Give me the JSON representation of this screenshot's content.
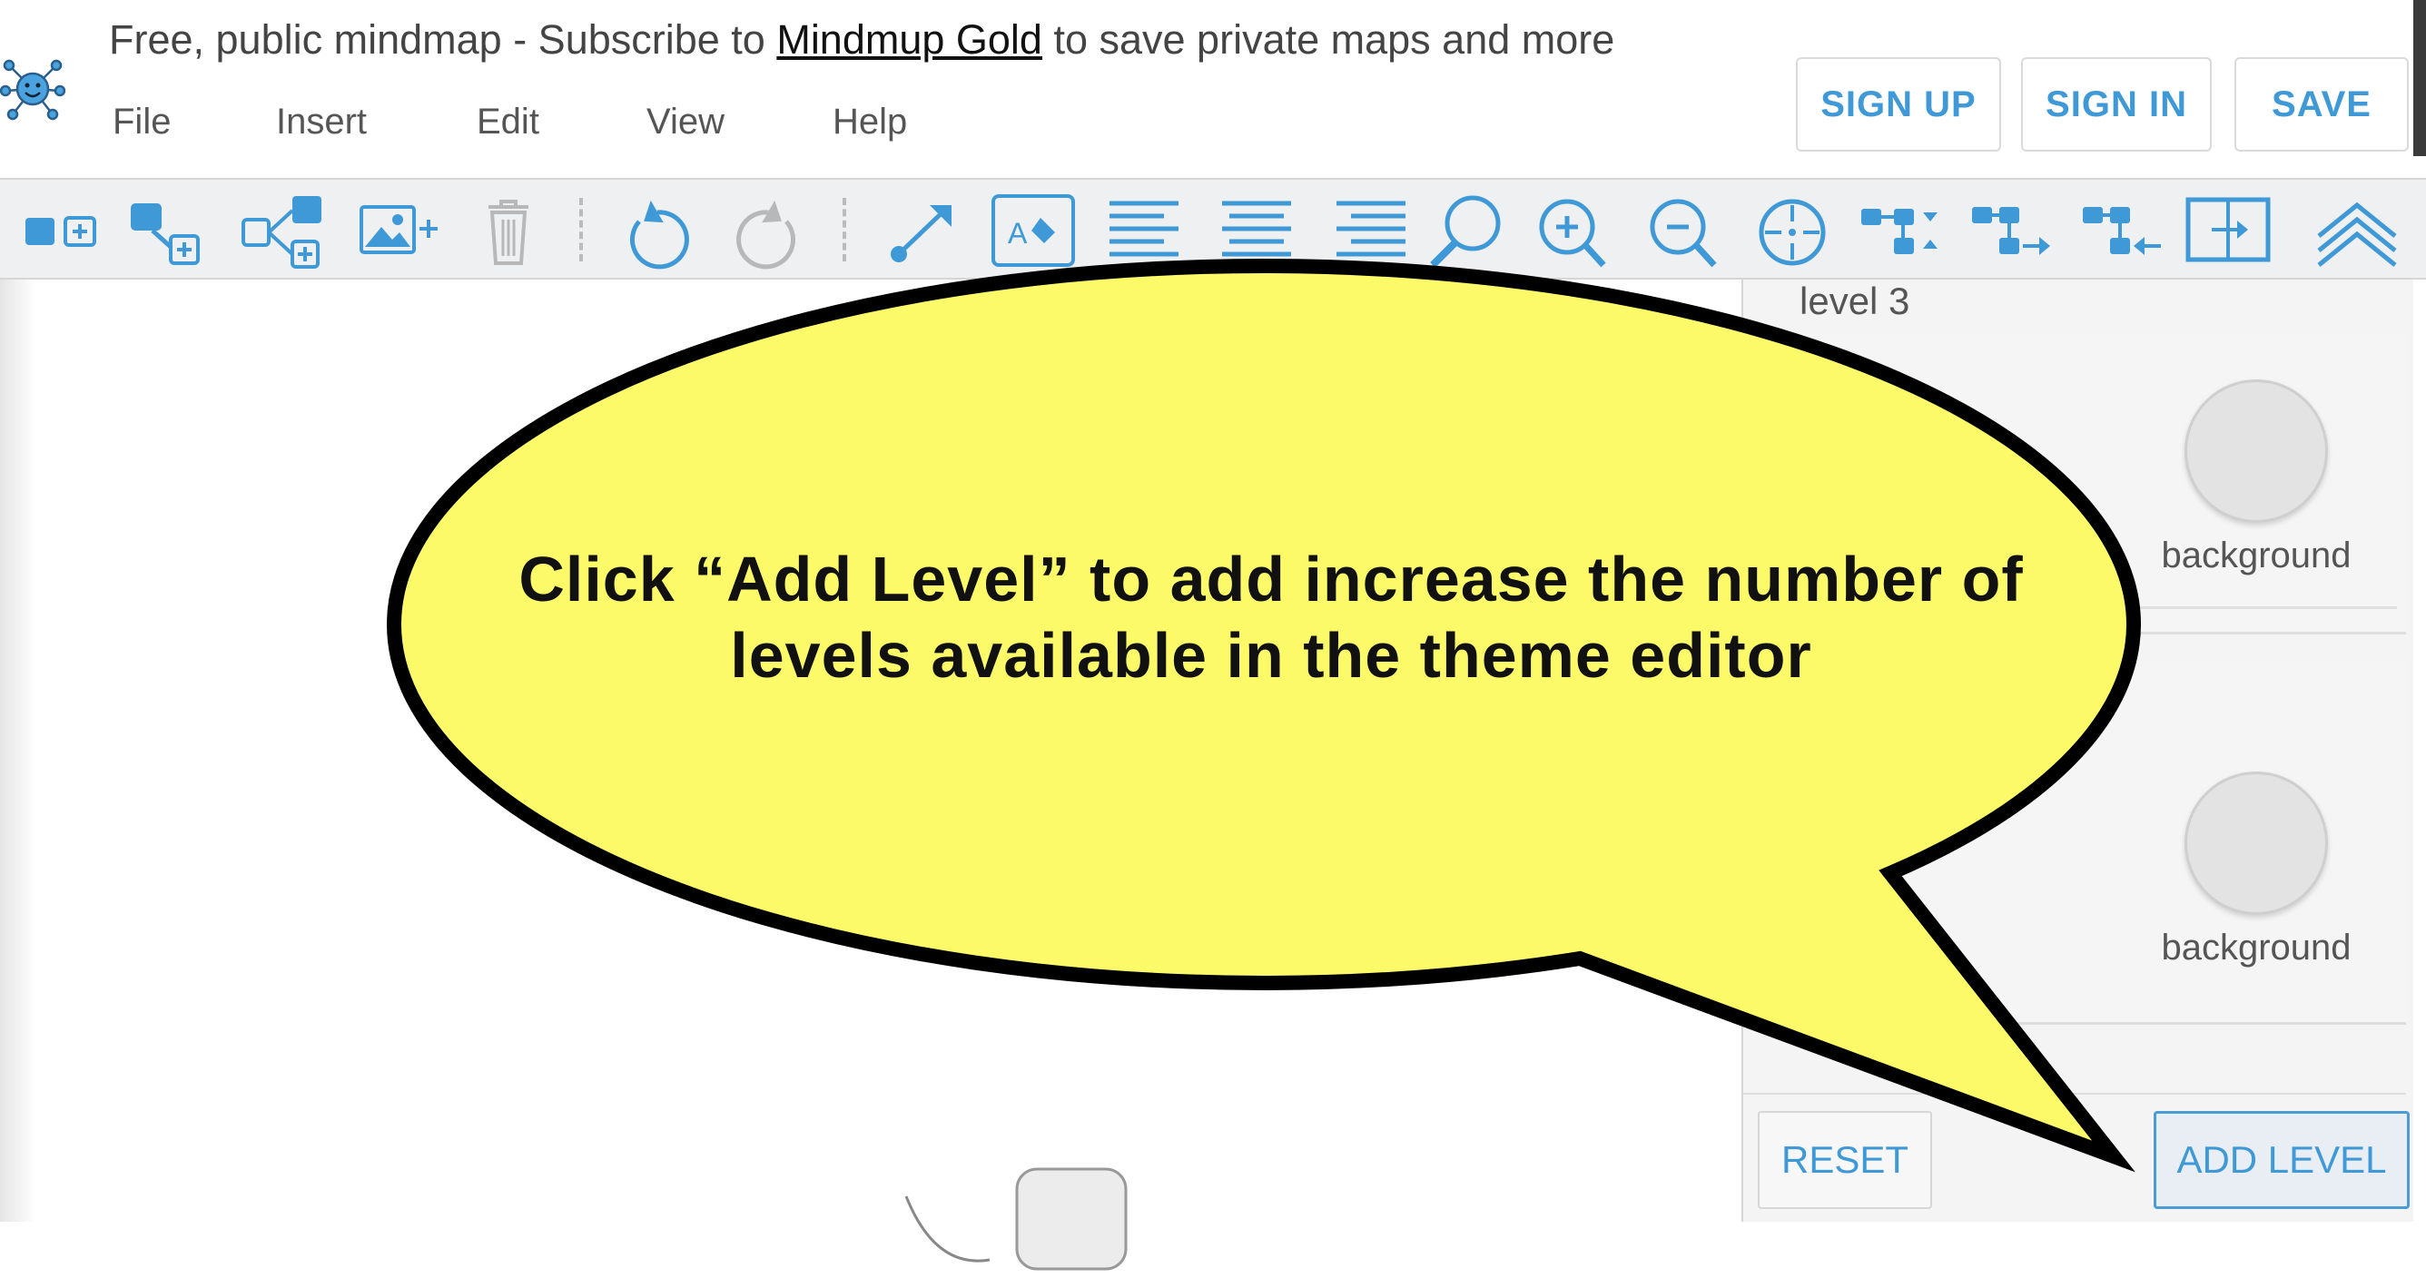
{
  "header": {
    "notice_prefix": "Free, public mindmap - Subscribe to ",
    "notice_link": "Mindmup Gold",
    "notice_suffix": " to save private maps and more",
    "menu": [
      "File",
      "Insert",
      "Edit",
      "View",
      "Help"
    ],
    "buttons": {
      "sign_up": "SIGN UP",
      "sign_in": "SIGN IN",
      "save": "SAVE"
    }
  },
  "toolbar": {
    "icons": [
      "add-child-node-icon",
      "add-sibling-node-icon",
      "add-subtree-icon",
      "insert-image-icon",
      "delete-icon",
      "undo-icon",
      "redo-icon",
      "add-link-icon",
      "text-style-icon",
      "align-left-icon",
      "align-center-icon",
      "align-right-icon",
      "zoom-search-icon",
      "zoom-in-icon",
      "zoom-out-icon",
      "center-map-icon",
      "layout-top-down-icon",
      "layout-right-icon",
      "layout-left-icon",
      "fit-frame-icon",
      "collapse-toolbar-icon"
    ]
  },
  "theme_panel": {
    "level_label": "level 3",
    "swatches": [
      {
        "label": "background",
        "color": "#e3e3e3"
      },
      {
        "label": "background",
        "color": "#e3e3e3"
      }
    ],
    "buttons": {
      "reset": "RESET",
      "add_level": "ADD LEVEL"
    }
  },
  "callout": {
    "line1": "Click “Add Level” to add increase the number of",
    "line2": "levels available in the theme editor",
    "fill": "#fdfa6a"
  },
  "colors": {
    "accent": "#3f99d6",
    "toolbar_bg": "#eef0f2"
  }
}
